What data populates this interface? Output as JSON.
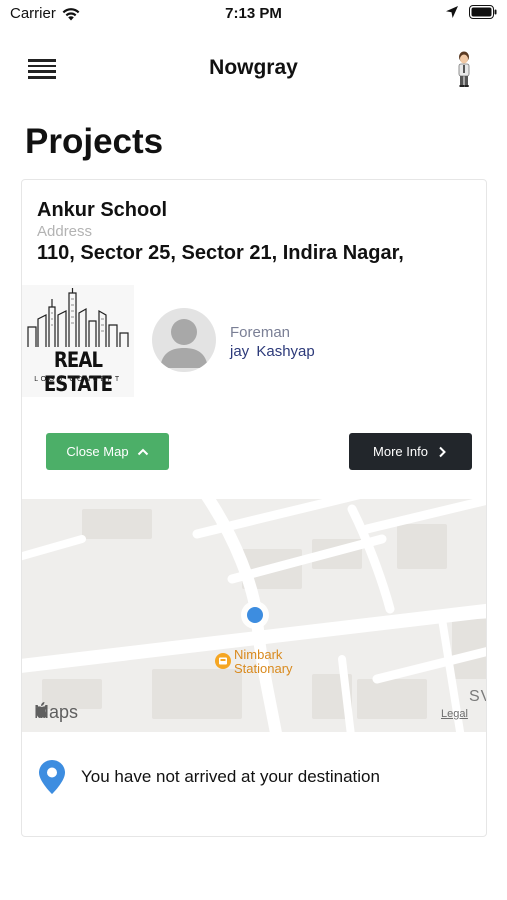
{
  "status_bar": {
    "carrier": "Carrier",
    "time": "7:13 PM"
  },
  "nav": {
    "title": "Nowgray"
  },
  "page": {
    "title": "Projects"
  },
  "project": {
    "name": "Ankur School",
    "address_label": "Address",
    "address": "110, Sector 25, Sector 21, Indira Nagar,",
    "logo": {
      "line1": "REAL ESTATE",
      "line2": "LOGO CONCEPT"
    },
    "foreman_label": "Foreman",
    "foreman_name": "jay Kashyap"
  },
  "buttons": {
    "close_map": "Close Map",
    "more_info": "More Info"
  },
  "map": {
    "poi_line1": "Nimbark",
    "poi_line2": "Stationary",
    "brand": "Maps",
    "legal": "Legal",
    "edge_label": "SV"
  },
  "arrival": {
    "message": "You have not arrived at your destination"
  },
  "colors": {
    "green": "#4caf68",
    "dark": "#22262b",
    "pin_blue": "#3d8de0",
    "poi_orange": "#d98a1e"
  }
}
